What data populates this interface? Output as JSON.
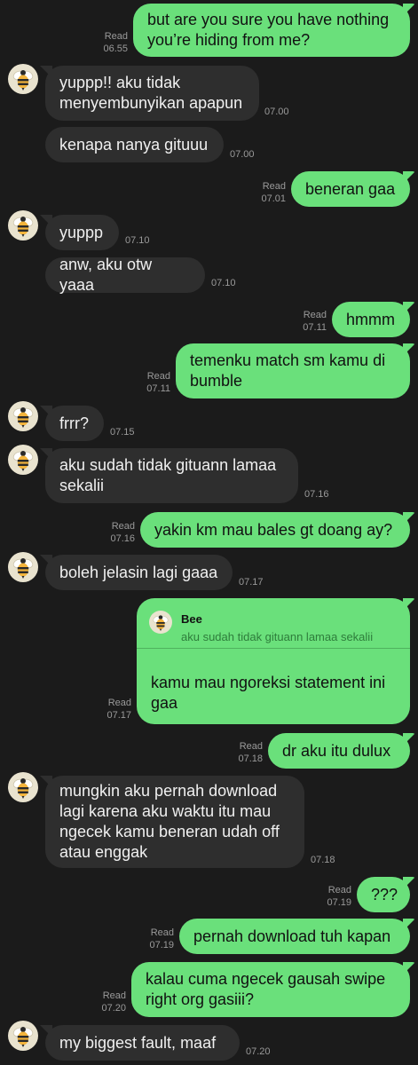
{
  "contact": {
    "name": "Bee"
  },
  "messages": [
    {
      "id": "m1",
      "dir": "out",
      "text": "but are you sure you have nothing you’re hiding from me?",
      "status": "Read",
      "time": "06.55"
    },
    {
      "id": "m2",
      "dir": "in",
      "text": "yuppp!! aku tidak menyembunyikan apapun",
      "time": "07.00"
    },
    {
      "id": "m3",
      "dir": "in",
      "text": "kenapa nanya gituuu",
      "time": "07.00"
    },
    {
      "id": "m4",
      "dir": "out",
      "text": "beneran gaa",
      "status": "Read",
      "time": "07.01"
    },
    {
      "id": "m5",
      "dir": "in",
      "text": "yuppp",
      "time": "07.10"
    },
    {
      "id": "m6",
      "dir": "in",
      "text": "anw, aku otw yaaa",
      "time": "07.10"
    },
    {
      "id": "m7",
      "dir": "out",
      "text": "hmmm",
      "status": "Read",
      "time": "07.11"
    },
    {
      "id": "m8",
      "dir": "out",
      "text": "temenku match sm kamu di bumble",
      "status": "Read",
      "time": "07.11"
    },
    {
      "id": "m9",
      "dir": "in",
      "text": "frrr?",
      "time": "07.15"
    },
    {
      "id": "m10",
      "dir": "in",
      "text": "aku sudah tidak gituann lamaa sekalii",
      "time": "07.16"
    },
    {
      "id": "m11",
      "dir": "out",
      "text": "yakin km mau bales gt doang ay?",
      "status": "Read",
      "time": "07.16"
    },
    {
      "id": "m12",
      "dir": "in",
      "text": "boleh jelasin lagi gaaa",
      "time": "07.17"
    },
    {
      "id": "m13",
      "dir": "out",
      "text": "kamu mau ngoreksi statement ini gaa",
      "status": "Read",
      "time": "07.17",
      "reply": {
        "name": "Bee",
        "text": "aku sudah tidak gituann lamaa sekalii"
      }
    },
    {
      "id": "m14",
      "dir": "out",
      "text": "dr aku itu dulux",
      "status": "Read",
      "time": "07.18"
    },
    {
      "id": "m15",
      "dir": "in",
      "text": "mungkin aku pernah download lagi karena aku waktu itu mau ngecek kamu beneran udah off atau enggak",
      "time": "07.18"
    },
    {
      "id": "m16",
      "dir": "out",
      "text": "???",
      "status": "Read",
      "time": "07.19"
    },
    {
      "id": "m17",
      "dir": "out",
      "text": "pernah download tuh kapan",
      "status": "Read",
      "time": "07.19"
    },
    {
      "id": "m18",
      "dir": "out",
      "text": "kalau cuma ngecek gausah swipe right org gasiii?",
      "status": "Read",
      "time": "07.20"
    },
    {
      "id": "m19",
      "dir": "in",
      "text": "my biggest fault, maaf",
      "time": "07.20"
    }
  ],
  "colors": {
    "background": "#1b1b1b",
    "outgoing_bubble": "#6ae07b",
    "incoming_bubble": "#2e2e2e",
    "meta_text": "#9a9a9a"
  },
  "icons": {
    "avatar": "bee-avatar-icon"
  }
}
